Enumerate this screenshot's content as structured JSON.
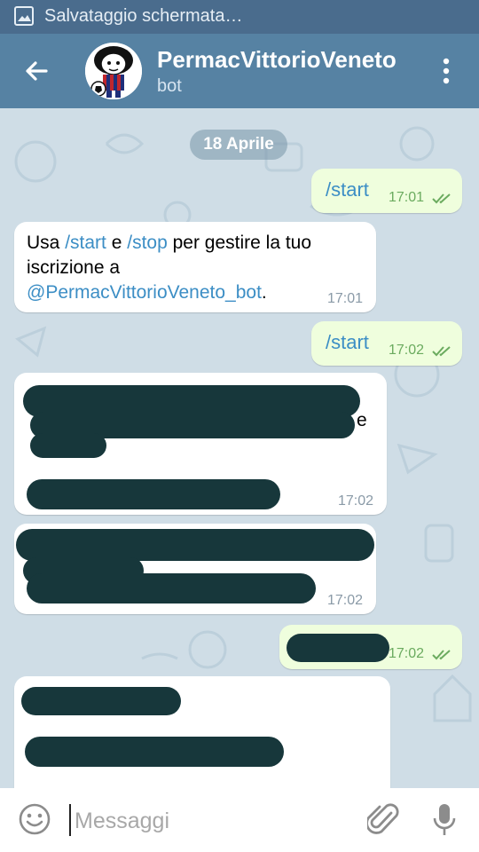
{
  "status_bar": {
    "notification_text": "Salvataggio schermata…",
    "icon": "screenshot-icon"
  },
  "header": {
    "title": "PermacVittorioVeneto",
    "subtitle": "bot",
    "back_icon": "back-arrow-icon",
    "menu_icon": "more-vertical-icon"
  },
  "chat": {
    "date_label": "18 Aprile",
    "messages": [
      {
        "direction": "out",
        "text": "/start",
        "time": "17:01"
      },
      {
        "direction": "in",
        "parts": [
          "Usa ",
          "/start",
          " e ",
          "/stop",
          " per gestire la tuo",
          "iscrizione a",
          "@PermacVittorioVeneto_bot",
          "."
        ],
        "time": "17:01"
      },
      {
        "direction": "out",
        "text": "/start",
        "time": "17:02"
      },
      {
        "direction": "in",
        "text": "",
        "visible_fragment": "e",
        "redacted": true,
        "time": "17:02"
      },
      {
        "direction": "in",
        "text": "",
        "redacted": true,
        "time": "17:02"
      },
      {
        "direction": "out",
        "text": "",
        "redacted": true,
        "time": "17:02"
      },
      {
        "direction": "in",
        "text": "",
        "redacted": true,
        "time": ""
      }
    ]
  },
  "composer": {
    "placeholder": "Messaggi",
    "emoji_icon": "emoji-icon",
    "attach_icon": "paperclip-icon",
    "mic_icon": "microphone-icon"
  },
  "colors": {
    "status_bar": "#4a6c8d",
    "app_bar": "#5682a3",
    "chat_background": "#cfdde6",
    "outgoing_bubble": "#effedd",
    "incoming_bubble": "#ffffff",
    "link": "#3c8ec5",
    "read_checks": "#6bab5f",
    "redaction": "#17373b"
  }
}
